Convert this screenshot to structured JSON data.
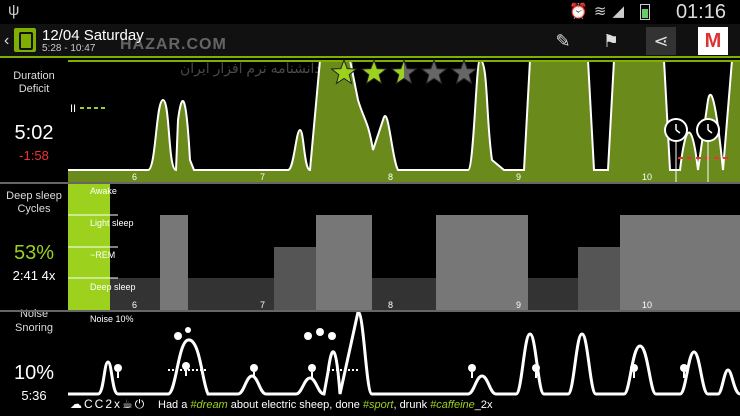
{
  "status": {
    "time": "01:16"
  },
  "header": {
    "title": "12/04 Saturday",
    "subtitle": "5:28 - 10:47",
    "watermark": "HAZAR.COM"
  },
  "persian_text": "اولین دانشنامه نرم افزار ایران",
  "sections": {
    "duration": {
      "label1": "Duration",
      "label2": "Deficit",
      "value": "5:02",
      "deficit": "-1:58"
    },
    "deep": {
      "label1": "Deep sleep",
      "label2": "Cycles",
      "percent": "53%",
      "cycles": "2:41 4x"
    },
    "noise": {
      "label1": "Noise",
      "label2": "Snoring",
      "percent": "10%",
      "duration": "5:36"
    }
  },
  "graph_labels": {
    "awake": "Awake",
    "light": "Light sleep",
    "rem": "~REM",
    "deep": "Deep sleep",
    "noise": "Noise 10%",
    "hours": [
      "6",
      "7",
      "8",
      "9",
      "10"
    ]
  },
  "rating": {
    "value": 2.5,
    "max": 5
  },
  "note": {
    "prefix": "Had a ",
    "dream": "#dream",
    "mid1": " about electric sheep, done ",
    "sport": "#sport",
    "mid2": ", drunk ",
    "caffeine": "#caffeine",
    "suffix": "_2x"
  },
  "colors": {
    "accent": "#7fb000",
    "light_green": "#9cd21e",
    "deficit": "#e33"
  }
}
